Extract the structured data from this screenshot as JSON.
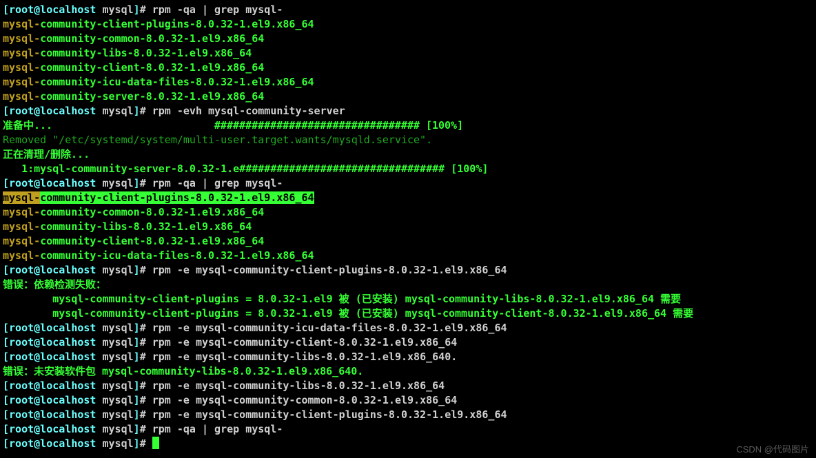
{
  "prompt": {
    "bracket_open": "[",
    "user_host": "root@localhost",
    "cwd": " mysql",
    "bracket_close": "]",
    "hash": "# "
  },
  "cmds": {
    "c01": "rpm -qa | grep mysql-",
    "c02": "rpm -evh mysql-community-server",
    "c03": "rpm -qa | grep mysql-",
    "c04": "rpm -e mysql-community-client-plugins-8.0.32-1.el9.x86_64",
    "c05": "rpm -e mysql-community-icu-data-files-8.0.32-1.el9.x86_64",
    "c06": "rpm -e mysql-community-client-8.0.32-1.el9.x86_64",
    "c07": "rpm -e mysql-community-libs-8.0.32-1.el9.x86_640.",
    "c08": "rpm -e mysql-community-libs-8.0.32-1.el9.x86_64",
    "c09": "rpm -e mysql-community-common-8.0.32-1.el9.x86_64",
    "c10": "rpm -e mysql-community-client-plugins-8.0.32-1.el9.x86_64",
    "c11": "rpm -qa | grep mysql-"
  },
  "pkg_prefix": "mysql-",
  "packages_list1": [
    "community-client-plugins-8.0.32-1.el9.x86_64",
    "community-common-8.0.32-1.el9.x86_64",
    "community-libs-8.0.32-1.el9.x86_64",
    "community-client-8.0.32-1.el9.x86_64",
    "community-icu-data-files-8.0.32-1.el9.x86_64",
    "community-server-8.0.32-1.el9.x86_64"
  ],
  "packages_list2": [
    "community-client-plugins-8.0.32-1.el9.x86_64",
    "community-common-8.0.32-1.el9.x86_64",
    "community-libs-8.0.32-1.el9.x86_64",
    "community-client-8.0.32-1.el9.x86_64",
    "community-icu-data-files-8.0.32-1.el9.x86_64"
  ],
  "erase": {
    "preparing": "准备中...                          ################################# [100%]",
    "removed": "Removed \"/etc/systemd/system/multi-user.target.wants/mysqld.service\".",
    "cleaning": "正在清理/删除...",
    "progress": "   1:mysql-community-server-8.0.32-1.e################################# [100%]"
  },
  "dep_error": {
    "title": "错误：依赖检测失败：",
    "lines": [
      "        mysql-community-client-plugins = 8.0.32-1.el9 被 (已安装) mysql-community-libs-8.0.32-1.el9.x86_64 需要",
      "        mysql-community-client-plugins = 8.0.32-1.el9 被 (已安装) mysql-community-client-8.0.32-1.el9.x86_64 需要"
    ]
  },
  "not_installed": "错误：未安装软件包 mysql-community-libs-8.0.32-1.el9.x86_640.",
  "watermark": "CSDN @代码图片"
}
